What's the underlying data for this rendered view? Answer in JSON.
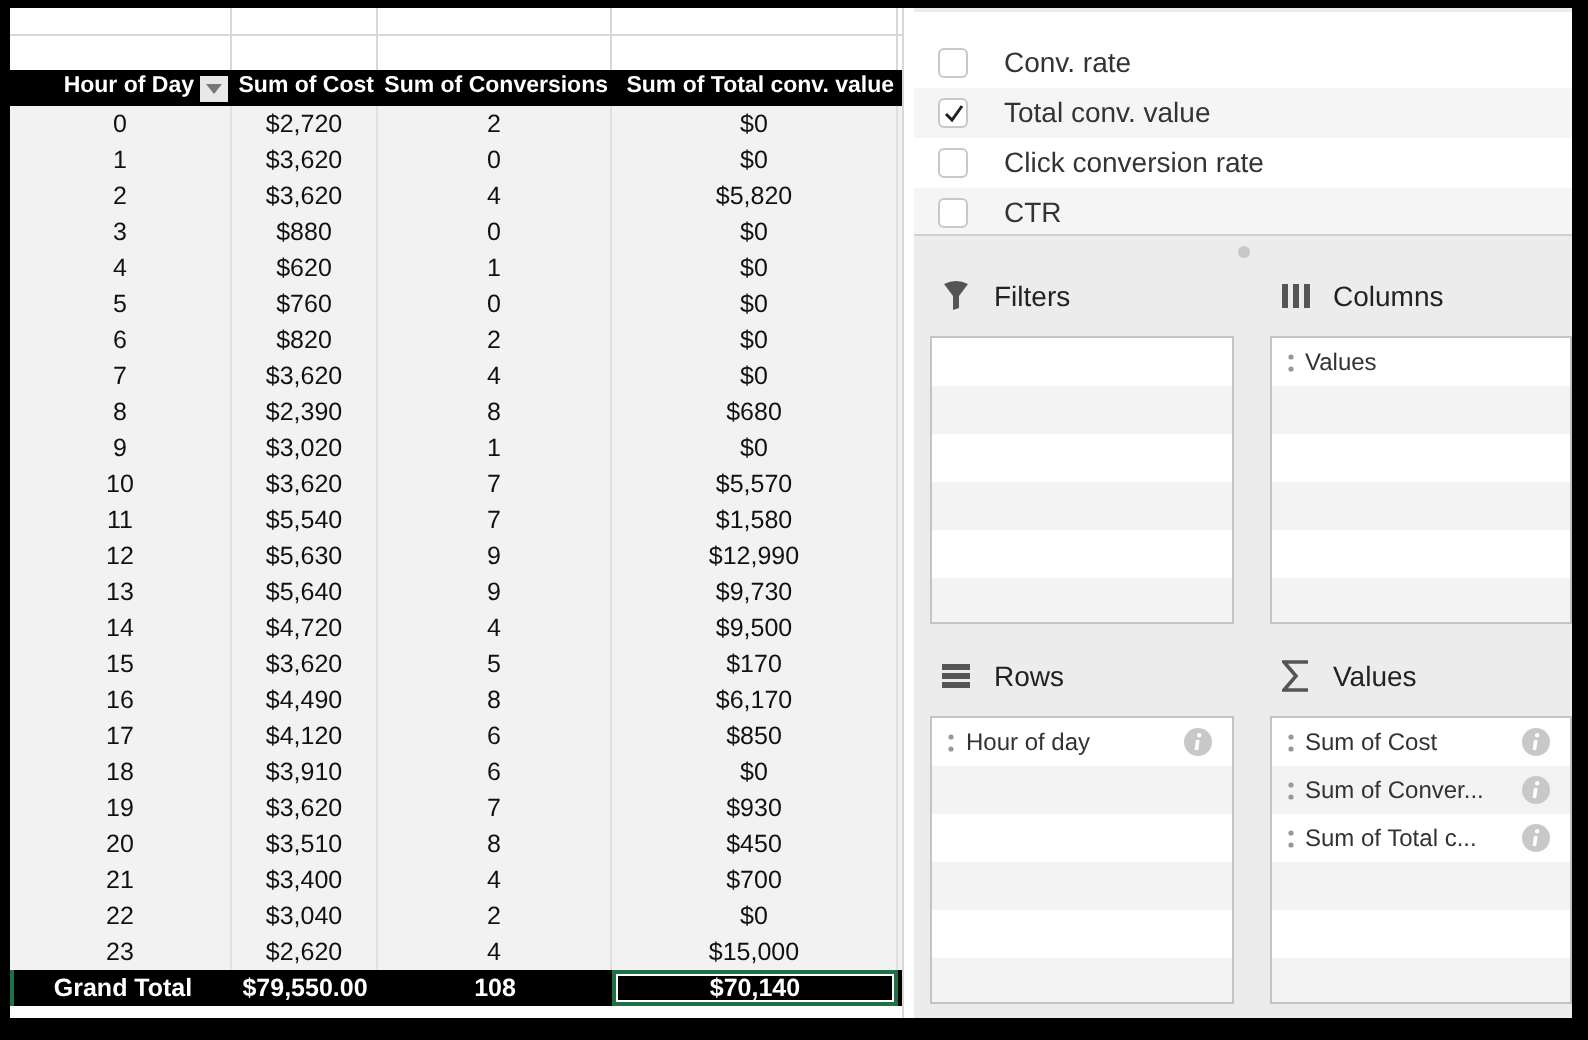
{
  "pivot_table": {
    "columns": [
      {
        "label": "Hour of Day",
        "filter_button": true
      },
      {
        "label": "Sum of Cost",
        "filter_button": false
      },
      {
        "label": "Sum of Conversions",
        "filter_button": false
      },
      {
        "label": "Sum of Total conv. value",
        "filter_button": false
      }
    ],
    "rows": [
      [
        "0",
        "$2,720",
        "2",
        "$0"
      ],
      [
        "1",
        "$3,620",
        "0",
        "$0"
      ],
      [
        "2",
        "$3,620",
        "4",
        "$5,820"
      ],
      [
        "3",
        "$880",
        "0",
        "$0"
      ],
      [
        "4",
        "$620",
        "1",
        "$0"
      ],
      [
        "5",
        "$760",
        "0",
        "$0"
      ],
      [
        "6",
        "$820",
        "2",
        "$0"
      ],
      [
        "7",
        "$3,620",
        "4",
        "$0"
      ],
      [
        "8",
        "$2,390",
        "8",
        "$680"
      ],
      [
        "9",
        "$3,020",
        "1",
        "$0"
      ],
      [
        "10",
        "$3,620",
        "7",
        "$5,570"
      ],
      [
        "11",
        "$5,540",
        "7",
        "$1,580"
      ],
      [
        "12",
        "$5,630",
        "9",
        "$12,990"
      ],
      [
        "13",
        "$5,640",
        "9",
        "$9,730"
      ],
      [
        "14",
        "$4,720",
        "4",
        "$9,500"
      ],
      [
        "15",
        "$3,620",
        "5",
        "$170"
      ],
      [
        "16",
        "$4,490",
        "8",
        "$6,170"
      ],
      [
        "17",
        "$4,120",
        "6",
        "$850"
      ],
      [
        "18",
        "$3,910",
        "6",
        "$0"
      ],
      [
        "19",
        "$3,620",
        "7",
        "$930"
      ],
      [
        "20",
        "$3,510",
        "8",
        "$450"
      ],
      [
        "21",
        "$3,400",
        "4",
        "$700"
      ],
      [
        "22",
        "$3,040",
        "2",
        "$0"
      ],
      [
        "23",
        "$2,620",
        "4",
        "$15,000"
      ]
    ],
    "grand_total": [
      {
        "text": "Grand Total",
        "selected": false
      },
      {
        "text": "$79,550.00",
        "selected": false
      },
      {
        "text": "108",
        "selected": false
      },
      {
        "text": "$70,140",
        "selected": true
      }
    ]
  },
  "field_list": [
    {
      "label": "Conv. rate",
      "checked": false
    },
    {
      "label": "Total conv. value",
      "checked": true
    },
    {
      "label": "Click conversion rate",
      "checked": false
    },
    {
      "label": "CTR",
      "checked": false
    }
  ],
  "zones": [
    {
      "kind": "filters",
      "title": "Filters"
    },
    {
      "kind": "columns",
      "title": "Columns",
      "items": [
        {
          "label": "Values",
          "info_button": false
        }
      ]
    },
    {
      "kind": "rows",
      "title": "Rows",
      "items": [
        {
          "label": "Hour of day",
          "info_button": true
        }
      ]
    },
    {
      "kind": "values",
      "title": "Values",
      "items": [
        {
          "label": "Sum of Cost",
          "info_button": true
        },
        {
          "label": "Sum of Conver...",
          "info_button": true
        },
        {
          "label": "Sum of Total c...",
          "info_button": true
        }
      ]
    }
  ]
}
